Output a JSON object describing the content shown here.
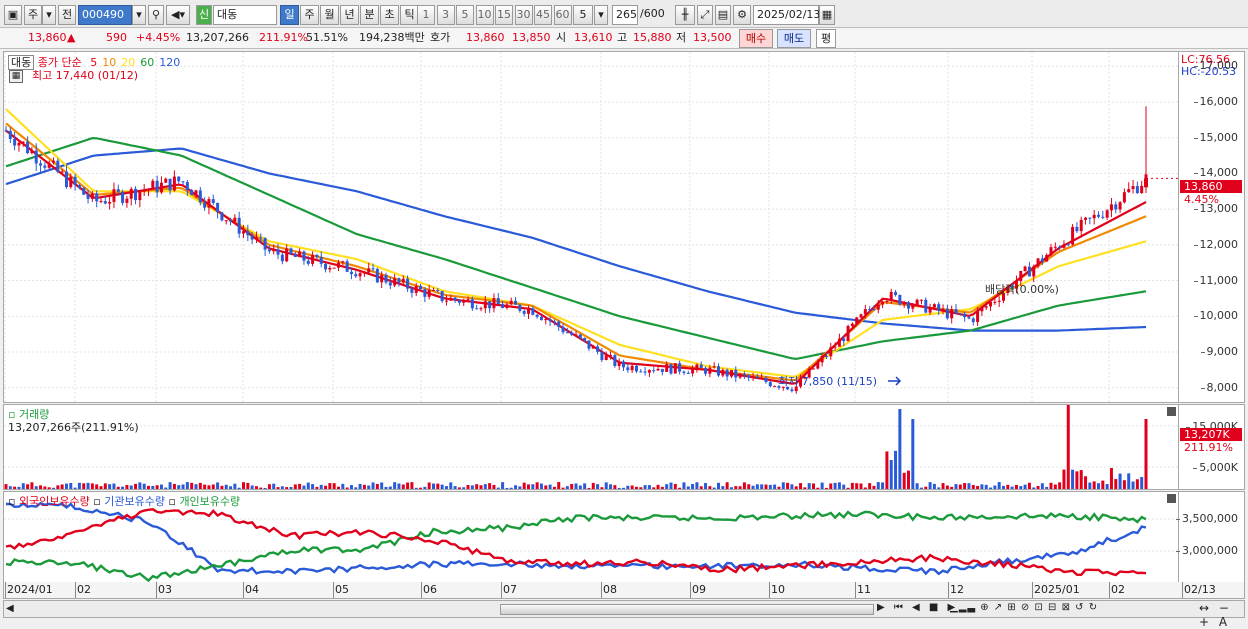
{
  "toolbar": {
    "market_type": "주",
    "market_prefix": "전",
    "stock_code": "000490",
    "new_badge": "신",
    "stock_name": "대동",
    "periods": [
      "일",
      "주",
      "월",
      "년",
      "분",
      "초",
      "틱"
    ],
    "active_period": "일",
    "intervals": [
      "1",
      "3",
      "5",
      "10",
      "15",
      "30",
      "45",
      "60"
    ],
    "custom_interval": "5",
    "data_count": "265",
    "data_total": "/600",
    "date": "2025/02/13"
  },
  "quote": {
    "price": "13,860",
    "change_arrow": "▲",
    "change": "590",
    "change_pct": "+4.45%",
    "volume": "13,207,266",
    "volume_ratio": "211.91%",
    "turnover": "51.51%",
    "amount": "194,238백만",
    "bid_label": "호가",
    "ask_price": "13,860",
    "bid_price": "13,850",
    "open_label": "시",
    "open": "13,610",
    "high_label": "고",
    "high": "15,880",
    "low_label": "저",
    "low": "13,500",
    "buy_label": "매수",
    "sell_label": "매도",
    "eval_label": "평"
  },
  "price_panel": {
    "stock_tag": "대동",
    "ma_title": "종가 단순",
    "ma_periods": [
      "5",
      "10",
      "20",
      "60",
      "120"
    ],
    "ma_colors": [
      "#e0001b",
      "#f08a00",
      "#ffe020",
      "#1a9a3a",
      "#2a5ad8"
    ],
    "high_text": "최고 17,440 (01/12)",
    "low_text": "최저 7,850 (11/15)",
    "dividend_text": "배당락(0.00%)",
    "lc_text": "LC:76.56",
    "hc_text": "HC:-20.53",
    "y_ticks": [
      "17,000",
      "16,000",
      "15,000",
      "14,000",
      "13,000",
      "12,000",
      "11,000",
      "10,000",
      "9,000",
      "8,000"
    ],
    "current_tag": "13,860",
    "current_pct": "4.45%"
  },
  "volume_panel": {
    "title": "거래량",
    "value_text": "13,207,266주(211.91%)",
    "y_ticks": [
      "15,000K",
      "5,000K"
    ],
    "current_tag": "13,207K",
    "current_pct": "211.91%"
  },
  "holding_panel": {
    "series": [
      "외국인보유수량",
      "기관보유수량",
      "개인보유수량"
    ],
    "series_colors": [
      "#e0001b",
      "#2a5ad8",
      "#1a9a3a"
    ],
    "y_ticks": [
      "3,500,000",
      "3,000,000"
    ]
  },
  "x_axis": {
    "labels": [
      "2024/01",
      "02",
      "03",
      "04",
      "05",
      "06",
      "07",
      "08",
      "09",
      "10",
      "11",
      "12",
      "2025/01",
      "02",
      "02/13"
    ]
  },
  "chart_data": {
    "type": "candlestick",
    "ylim": [
      7600,
      17400
    ],
    "x": [
      "2024/01",
      "02",
      "03",
      "04",
      "05",
      "06",
      "07",
      "08",
      "09",
      "10",
      "11",
      "12",
      "2025/01",
      "02/13"
    ],
    "close_monthly": [
      15200,
      13200,
      13800,
      11800,
      11300,
      10500,
      10200,
      8600,
      8500,
      8000,
      10600,
      9900,
      12000,
      13860
    ],
    "series": [
      {
        "name": "5",
        "values": [
          15200,
          13300,
          13700,
          11900,
          11300,
          10500,
          10200,
          8700,
          8500,
          8100,
          10500,
          10000,
          11900,
          13200
        ]
      },
      {
        "name": "10",
        "values": [
          15400,
          13400,
          13600,
          12000,
          11400,
          10600,
          10300,
          8900,
          8500,
          8200,
          10400,
          10100,
          11800,
          12800
        ]
      },
      {
        "name": "20",
        "values": [
          15800,
          13500,
          13500,
          12100,
          11600,
          10700,
          10300,
          9200,
          8600,
          8300,
          9900,
          10200,
          11400,
          12100
        ]
      },
      {
        "name": "60",
        "values": [
          14200,
          15000,
          14500,
          13400,
          12300,
          11600,
          10800,
          10000,
          9400,
          8800,
          9300,
          9600,
          10300,
          10700
        ]
      },
      {
        "name": "120",
        "values": [
          13700,
          14500,
          14700,
          14000,
          13500,
          12800,
          12200,
          11400,
          10700,
          10100,
          9800,
          9600,
          9600,
          9700
        ]
      }
    ]
  }
}
